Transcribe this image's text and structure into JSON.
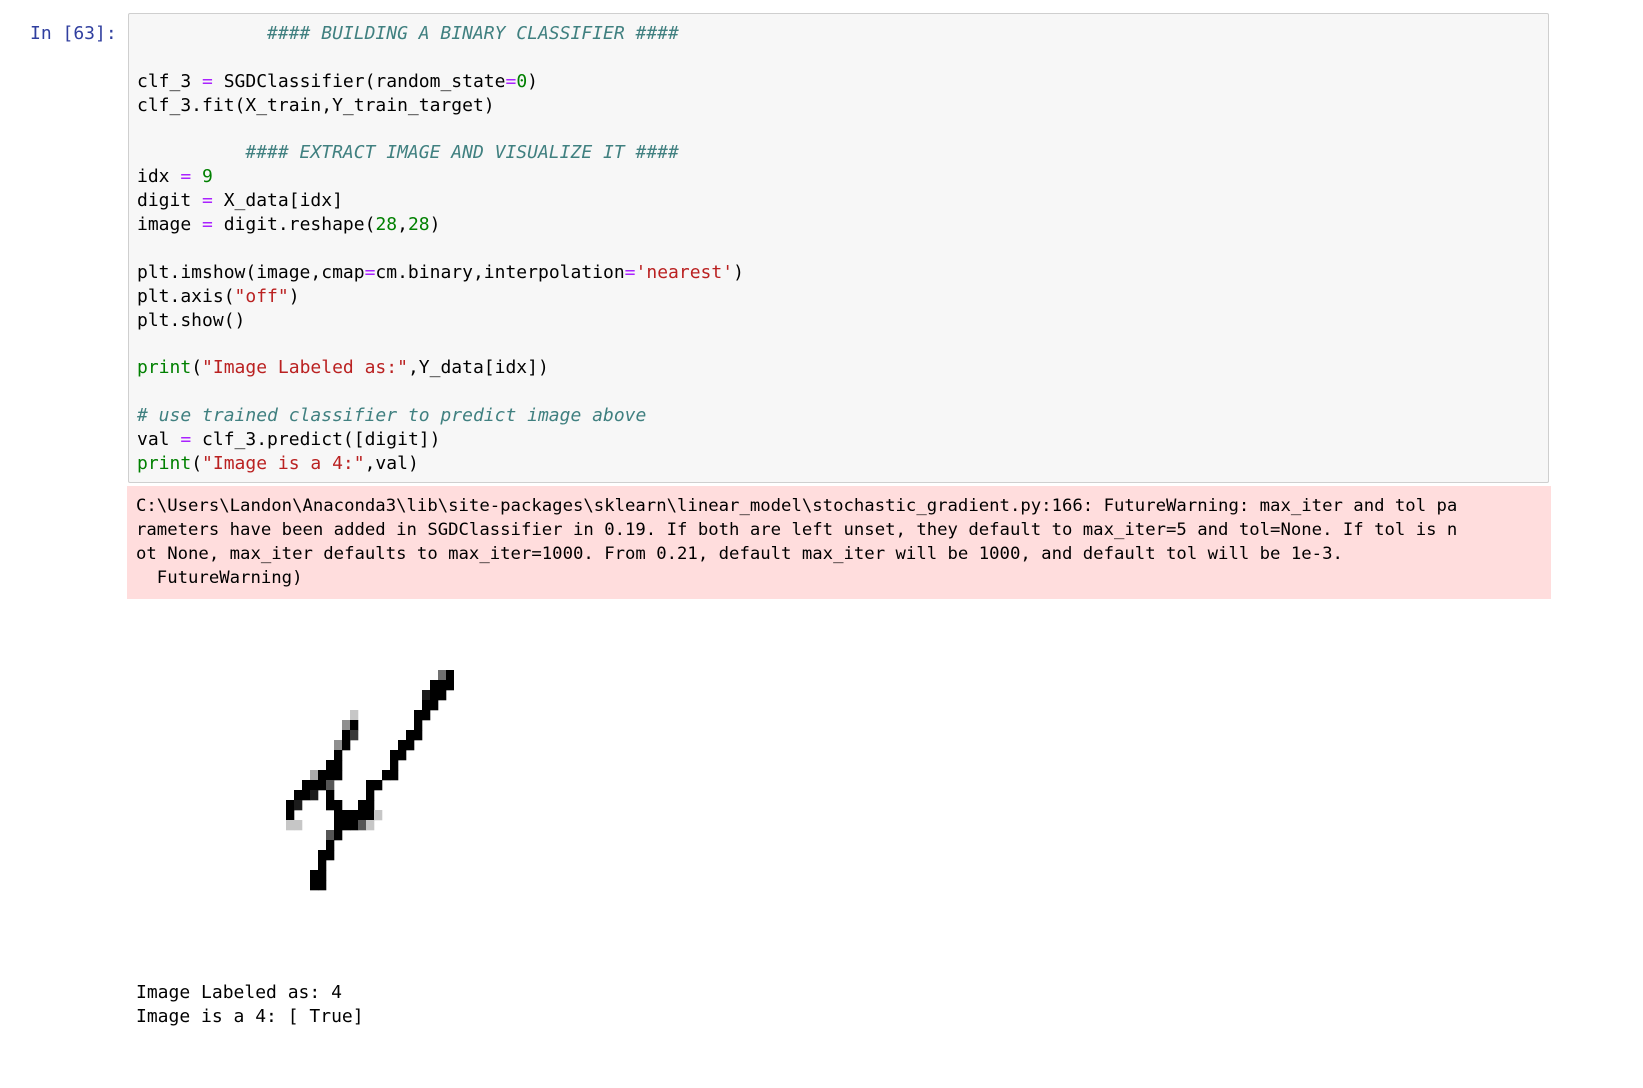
{
  "cell": {
    "prompt": "In [63]:",
    "code_lines": [
      [
        {
          "t": "            #### BUILDING A BINARY CLASSIFIER ####",
          "c": "cm"
        }
      ],
      [],
      [
        {
          "t": "clf_3 "
        },
        {
          "t": "=",
          "c": "o"
        },
        {
          "t": " SGDClassifier(random_state"
        },
        {
          "t": "=",
          "c": "o"
        },
        {
          "t": "0",
          "c": "n"
        },
        {
          "t": ")"
        }
      ],
      [
        {
          "t": "clf_3.fit(X_train,Y_train_target)"
        }
      ],
      [],
      [
        {
          "t": "          #### EXTRACT IMAGE AND VISUALIZE IT ####",
          "c": "cm"
        }
      ],
      [
        {
          "t": "idx "
        },
        {
          "t": "=",
          "c": "o"
        },
        {
          "t": " "
        },
        {
          "t": "9",
          "c": "n"
        }
      ],
      [
        {
          "t": "digit "
        },
        {
          "t": "=",
          "c": "o"
        },
        {
          "t": " X_data[idx]"
        }
      ],
      [
        {
          "t": "image "
        },
        {
          "t": "=",
          "c": "o"
        },
        {
          "t": " digit.reshape("
        },
        {
          "t": "28",
          "c": "n"
        },
        {
          "t": ","
        },
        {
          "t": "28",
          "c": "n"
        },
        {
          "t": ")"
        }
      ],
      [],
      [
        {
          "t": "plt.imshow(image,cmap"
        },
        {
          "t": "=",
          "c": "o"
        },
        {
          "t": "cm.binary,interpolation"
        },
        {
          "t": "=",
          "c": "o"
        },
        {
          "t": "'nearest'",
          "c": "s"
        },
        {
          "t": ")"
        }
      ],
      [
        {
          "t": "plt.axis("
        },
        {
          "t": "\"off\"",
          "c": "s"
        },
        {
          "t": ")"
        }
      ],
      [
        {
          "t": "plt.show()"
        }
      ],
      [],
      [
        {
          "t": "print",
          "c": "b"
        },
        {
          "t": "("
        },
        {
          "t": "\"Image Labeled as:\"",
          "c": "s"
        },
        {
          "t": ",Y_data[idx])"
        }
      ],
      [],
      [
        {
          "t": "# use trained classifier to predict image above",
          "c": "cm"
        }
      ],
      [
        {
          "t": "val "
        },
        {
          "t": "=",
          "c": "o"
        },
        {
          "t": " clf_3.predict([digit])"
        }
      ],
      [
        {
          "t": "print",
          "c": "b"
        },
        {
          "t": "("
        },
        {
          "t": "\"Image is a 4:\"",
          "c": "s"
        },
        {
          "t": ",val)"
        }
      ]
    ]
  },
  "stderr": {
    "lines": [
      "C:\\Users\\Landon\\Anaconda3\\lib\\site-packages\\sklearn\\linear_model\\stochastic_gradient.py:166: FutureWarning: max_iter and tol pa",
      "rameters have been added in SGDClassifier in 0.19. If both are left unset, they default to max_iter=5 and tol=None. If tol is n",
      "ot None, max_iter defaults to max_iter=1000. From 0.21, default max_iter will be 1000, and default tol will be 1e-3.",
      "  FutureWarning)"
    ]
  },
  "digit_image": {
    "cmap": "binary",
    "rows": [
      "............................",
      "............................",
      "............................",
      "............................",
      "..........................59",
      ".........................999",
      "........................899.",
      "........................99..",
      "...............2.......99...",
      "..............49.......9....",
      "..............97......99....",
      ".............49......99.....",
      ".............9......99......",
      "............99......9.......",
      "..........3999.....99.......",
      ".........9996....99.........",
      "........998.9....9..........",
      ".......98...99..99..........",
      ".......9.....999992.........",
      ".......22....99962..........",
      "............69..............",
      "............9...............",
      "...........99...............",
      "...........9................",
      "..........99................",
      "..........99................",
      "............................",
      "............................"
    ]
  },
  "stdout": {
    "lines": [
      "Image Labeled as: 4",
      "Image is a 4: [ True]"
    ]
  }
}
